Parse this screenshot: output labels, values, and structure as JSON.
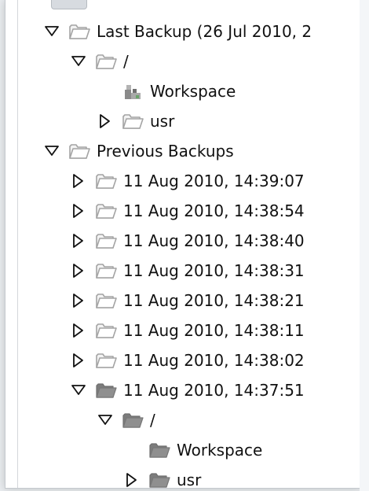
{
  "tree": {
    "nodes": [
      {
        "label": "Last Backup (26 Jul 2010, 2",
        "depth": 0,
        "toggle": "open",
        "icon": "folder-open-icon"
      },
      {
        "label": "/",
        "depth": 1,
        "toggle": "open",
        "icon": "folder-open-icon"
      },
      {
        "label": "Workspace",
        "depth": 2,
        "toggle": "none",
        "icon": "workspace-puzzle-icon"
      },
      {
        "label": "usr",
        "depth": 2,
        "toggle": "closed",
        "icon": "folder-open-icon"
      },
      {
        "label": "Previous Backups",
        "depth": 0,
        "toggle": "open",
        "icon": "folder-open-icon"
      },
      {
        "label": "11 Aug 2010, 14:39:07",
        "depth": 1,
        "toggle": "closed",
        "icon": "folder-open-icon"
      },
      {
        "label": "11 Aug 2010, 14:38:54",
        "depth": 1,
        "toggle": "closed",
        "icon": "folder-open-icon"
      },
      {
        "label": "11 Aug 2010, 14:38:40",
        "depth": 1,
        "toggle": "closed",
        "icon": "folder-open-icon"
      },
      {
        "label": "11 Aug 2010, 14:38:31",
        "depth": 1,
        "toggle": "closed",
        "icon": "folder-open-icon"
      },
      {
        "label": "11 Aug 2010, 14:38:21",
        "depth": 1,
        "toggle": "closed",
        "icon": "folder-open-icon"
      },
      {
        "label": "11 Aug 2010, 14:38:11",
        "depth": 1,
        "toggle": "closed",
        "icon": "folder-open-icon"
      },
      {
        "label": "11 Aug 2010, 14:38:02",
        "depth": 1,
        "toggle": "closed",
        "icon": "folder-open-icon"
      },
      {
        "label": "11 Aug 2010, 14:37:51",
        "depth": 1,
        "toggle": "open",
        "icon": "folder-filled-icon"
      },
      {
        "label": "/",
        "depth": 2,
        "toggle": "open",
        "icon": "folder-filled-icon"
      },
      {
        "label": "Workspace",
        "depth": 3,
        "toggle": "none",
        "icon": "folder-filled-icon"
      },
      {
        "label": "usr",
        "depth": 3,
        "toggle": "closed",
        "icon": "folder-filled-icon"
      }
    ]
  },
  "colors": {
    "folder_outline": "#a4a4a4",
    "folder_filled": "#8f8f8f",
    "workspace_icon": "#8a8a8a"
  }
}
